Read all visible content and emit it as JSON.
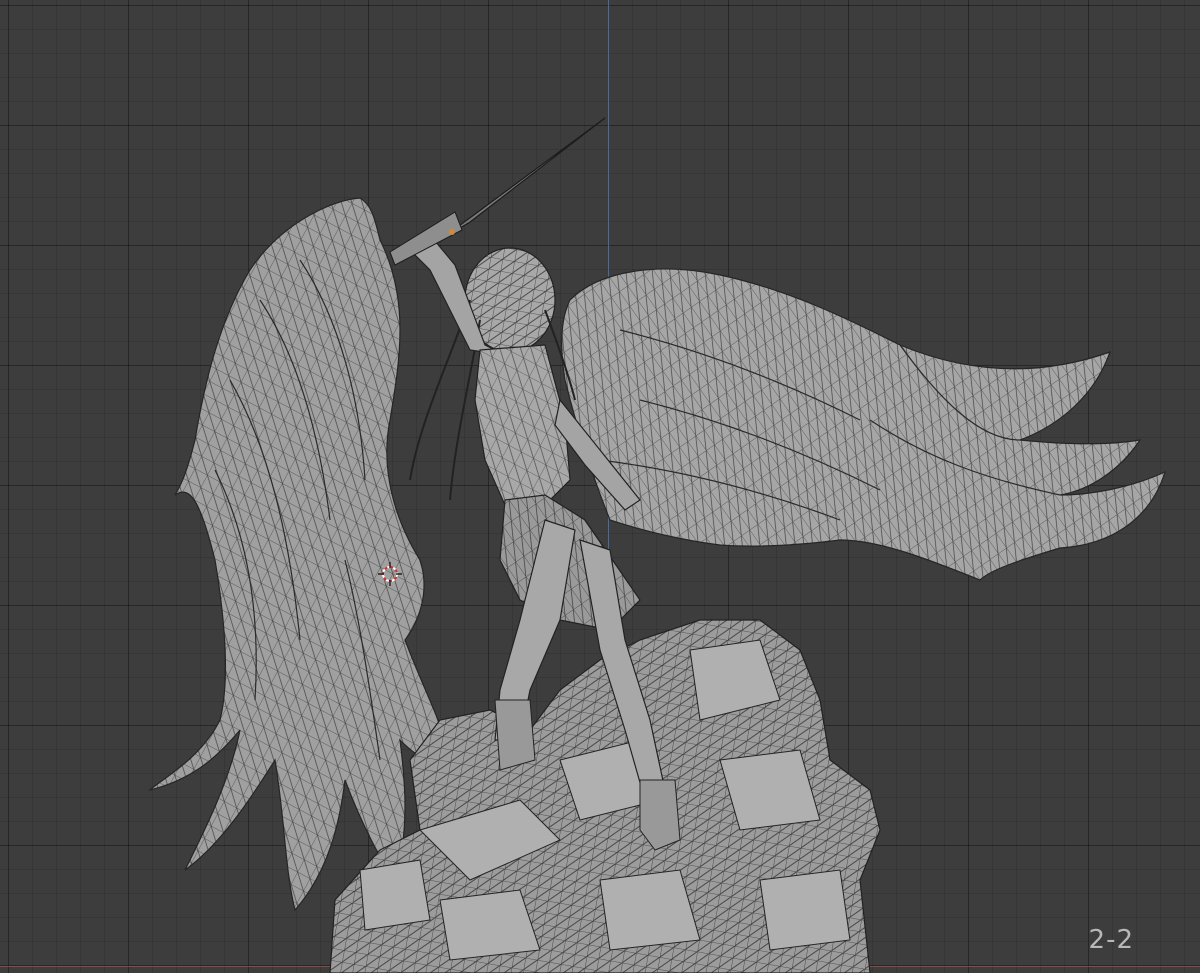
{
  "viewport": {
    "frame_label": "2-2",
    "background_color": "#3d3d3d",
    "grid_color": "#2e2e2e",
    "axis_y_color": "#4a78b8",
    "axis_x_color": "#9b4a4a",
    "mesh_fill_color": "#a3a3a3",
    "mesh_wire_color": "#1f1f1f"
  },
  "scene": {
    "subject": "angel-statue-wireframe",
    "icons": [
      "3d-cursor-icon"
    ]
  }
}
